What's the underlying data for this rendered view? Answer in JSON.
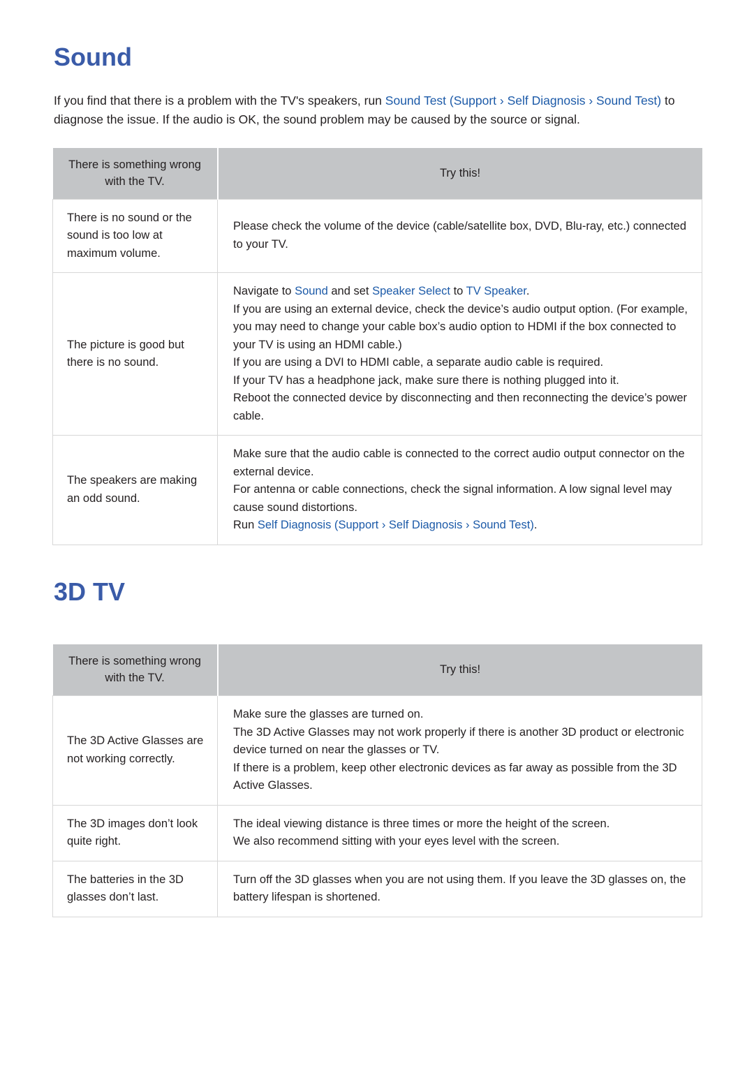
{
  "sections": [
    {
      "id": "sound",
      "title": "Sound",
      "intro": {
        "parts": [
          {
            "t": "If you find that there is a problem with the TV's speakers, run ",
            "s": "plain"
          },
          {
            "t": "Sound Test",
            "s": "link"
          },
          {
            "t": " (",
            "s": "link"
          },
          {
            "t": "Support",
            "s": "link"
          },
          {
            "t": " › ",
            "s": "link"
          },
          {
            "t": "Self Diagnosis",
            "s": "link"
          },
          {
            "t": " › ",
            "s": "link"
          },
          {
            "t": "Sound Test",
            "s": "link"
          },
          {
            "t": ")",
            "s": "link"
          },
          {
            "t": " to diagnose the issue. If the audio is OK, the sound problem may be caused by the source or signal.",
            "s": "plain"
          }
        ]
      },
      "table": {
        "headers": [
          "There is something wrong with the TV.",
          "Try this!"
        ],
        "rows": [
          {
            "problem": "There is no sound or the sound is too low at maximum volume.",
            "lines": [
              {
                "parts": [
                  {
                    "t": "Please check the volume of the device (cable/satellite box, DVD, Blu-ray, etc.) connected to your TV.",
                    "s": "plain"
                  }
                ]
              }
            ]
          },
          {
            "problem": "The picture is good but there is no sound.",
            "lines": [
              {
                "parts": [
                  {
                    "t": "Navigate to ",
                    "s": "plain"
                  },
                  {
                    "t": "Sound",
                    "s": "link"
                  },
                  {
                    "t": " and set ",
                    "s": "plain"
                  },
                  {
                    "t": "Speaker Select",
                    "s": "link"
                  },
                  {
                    "t": " to ",
                    "s": "plain"
                  },
                  {
                    "t": "TV Speaker",
                    "s": "link"
                  },
                  {
                    "t": ".",
                    "s": "plain"
                  }
                ]
              },
              {
                "parts": [
                  {
                    "t": "If you are using an external device, check the device’s audio output option. (For example, you may need to change your cable box’s audio option to HDMI if the box connected to your TV is using an HDMI cable.)",
                    "s": "plain"
                  }
                ]
              },
              {
                "parts": [
                  {
                    "t": "If you are using a DVI to HDMI cable, a separate audio cable is required.",
                    "s": "plain"
                  }
                ]
              },
              {
                "parts": [
                  {
                    "t": "If your TV has a headphone jack, make sure there is nothing plugged into it.",
                    "s": "plain"
                  }
                ]
              },
              {
                "parts": [
                  {
                    "t": "Reboot the connected device by disconnecting and then reconnecting the device’s power cable.",
                    "s": "plain"
                  }
                ]
              }
            ]
          },
          {
            "problem": "The speakers are making an odd sound.",
            "lines": [
              {
                "parts": [
                  {
                    "t": "Make sure that the audio cable is connected to the correct audio output connector on the external device.",
                    "s": "plain"
                  }
                ]
              },
              {
                "parts": [
                  {
                    "t": "For antenna or cable connections, check the signal information. A low signal level may cause sound distortions.",
                    "s": "plain"
                  }
                ]
              },
              {
                "parts": [
                  {
                    "t": "Run ",
                    "s": "plain"
                  },
                  {
                    "t": "Self Diagnosis",
                    "s": "link"
                  },
                  {
                    "t": " (",
                    "s": "link"
                  },
                  {
                    "t": "Support",
                    "s": "link"
                  },
                  {
                    "t": " › ",
                    "s": "link"
                  },
                  {
                    "t": "Self Diagnosis",
                    "s": "link"
                  },
                  {
                    "t": " › ",
                    "s": "link"
                  },
                  {
                    "t": "Sound Test",
                    "s": "link"
                  },
                  {
                    "t": ")",
                    "s": "link"
                  },
                  {
                    "t": ".",
                    "s": "plain"
                  }
                ]
              }
            ]
          }
        ]
      }
    },
    {
      "id": "3d-tv",
      "title": "3D TV",
      "intro": null,
      "table": {
        "headers": [
          "There is something wrong with the TV.",
          "Try this!"
        ],
        "rows": [
          {
            "problem": "The 3D Active Glasses are not working correctly.",
            "lines": [
              {
                "parts": [
                  {
                    "t": "Make sure the glasses are turned on.",
                    "s": "plain"
                  }
                ]
              },
              {
                "parts": [
                  {
                    "t": "The 3D Active Glasses may not work properly if there is another 3D product or electronic device turned on near the glasses or TV.",
                    "s": "plain"
                  }
                ]
              },
              {
                "parts": [
                  {
                    "t": "If there is a problem, keep other electronic devices as far away as possible from the 3D Active Glasses.",
                    "s": "plain"
                  }
                ]
              }
            ]
          },
          {
            "problem": "The 3D images don’t look quite right.",
            "lines": [
              {
                "parts": [
                  {
                    "t": "The ideal viewing distance is three times or more the height of the screen.",
                    "s": "plain"
                  }
                ]
              },
              {
                "parts": [
                  {
                    "t": "We also recommend sitting with your eyes level with the screen.",
                    "s": "plain"
                  }
                ]
              }
            ]
          },
          {
            "problem": "The batteries in the 3D glasses don’t last.",
            "lines": [
              {
                "parts": [
                  {
                    "t": "Turn off the 3D glasses when you are not using them. If you leave the 3D glasses on, the battery lifespan is shortened.",
                    "s": "plain"
                  }
                ]
              }
            ]
          }
        ]
      }
    }
  ],
  "colors": {
    "heading": "#3a5ba8",
    "link": "#1c5aa8",
    "table_header_bg": "#c3c5c7",
    "table_border": "#d7d7d7",
    "text": "#231f20"
  }
}
